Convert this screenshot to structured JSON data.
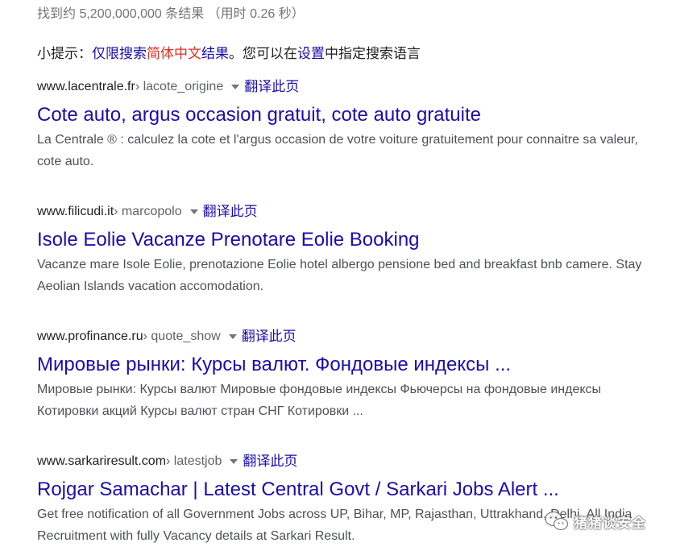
{
  "stats": "找到约 5,200,000,000 条结果  （用时 0.26 秒）",
  "tip": {
    "prefix": "小提示：",
    "link1": "仅限搜索",
    "link_red": "简体中文",
    "link2": "结果",
    "middle": "。您可以在",
    "settings_link": "设置",
    "suffix": "中指定搜索语言"
  },
  "results": [
    {
      "domain": "www.lacentrale.fr",
      "path": " › lacote_origine",
      "translate": "翻译此页",
      "title": "Cote auto, argus occasion gratuit, cote auto gratuite",
      "snippet": "La Centrale ® : calculez la cote et l'argus occasion de votre voiture gratuitement pour connaitre sa valeur, cote auto."
    },
    {
      "domain": "www.filicudi.it",
      "path": " › marcopolo",
      "translate": "翻译此页",
      "title": "Isole Eolie Vacanze Prenotare Eolie Booking",
      "snippet": "Vacanze mare Isole Eolie, prenotazione Eolie hotel albergo pensione bed and breakfast bnb camere. Stay Aeolian Islands vacation accomodation."
    },
    {
      "domain": "www.profinance.ru",
      "path": " › quote_show",
      "translate": "翻译此页",
      "title": "Мировые рынки: Курсы валют. Фондовые индексы ...",
      "snippet": "Мировые рынки: Курсы валют Мировые фондовые индексы Фьючерсы на фондовые индексы Котировки акций Курсы валют стран СНГ Котировки ..."
    },
    {
      "domain": "www.sarkariresult.com",
      "path": " › latestjob",
      "translate": "翻译此页",
      "title": "Rojgar Samachar | Latest Central Govt / Sarkari Jobs Alert ...",
      "snippet": "Get free notification of all Government Jobs across UP, Bihar, MP, Rajasthan, Uttrakhand, Delhi. All India Recruitment with fully Vacancy details at Sarkari Result."
    }
  ],
  "watermark": {
    "text": "猪猪谈安全",
    "icon": "wechat-icon"
  }
}
